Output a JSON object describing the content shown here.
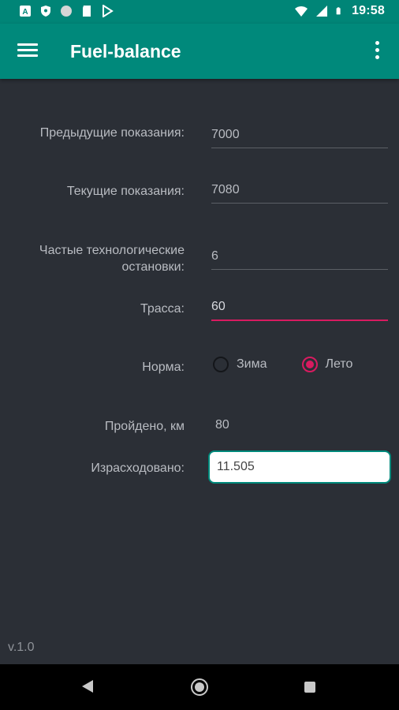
{
  "status_bar": {
    "time": "19:58",
    "icons": [
      "a-icon",
      "shield-icon",
      "circle-icon",
      "sd-card-icon",
      "play-store-icon",
      "wifi-icon",
      "signal-icon",
      "battery-icon"
    ]
  },
  "app_bar": {
    "title": "Fuel-balance",
    "menu_icon": "hamburger-menu-icon",
    "overflow_icon": "more-vertical-icon"
  },
  "form": {
    "prev_label": "Предыдущие показания:",
    "prev_value": "7000",
    "curr_label": "Текущие показания:",
    "curr_value": "7080",
    "stops_label_1": "Частые технологические",
    "stops_label_2": "остановки:",
    "stops_value": "6",
    "route_label": "Трасса:",
    "route_value": "60",
    "norm_label": "Норма:",
    "norm_options": [
      "Зима",
      "Лето"
    ],
    "norm_selected": "Лето",
    "distance_label": "Пройдено, км",
    "distance_value": "80",
    "consumed_label": "Израсходовано:",
    "consumed_value": "11.505"
  },
  "footer": {
    "version": "v.1.0"
  },
  "colors": {
    "app_bar": "#00897b",
    "accent": "#d81b60",
    "background": "#2b2f36"
  }
}
